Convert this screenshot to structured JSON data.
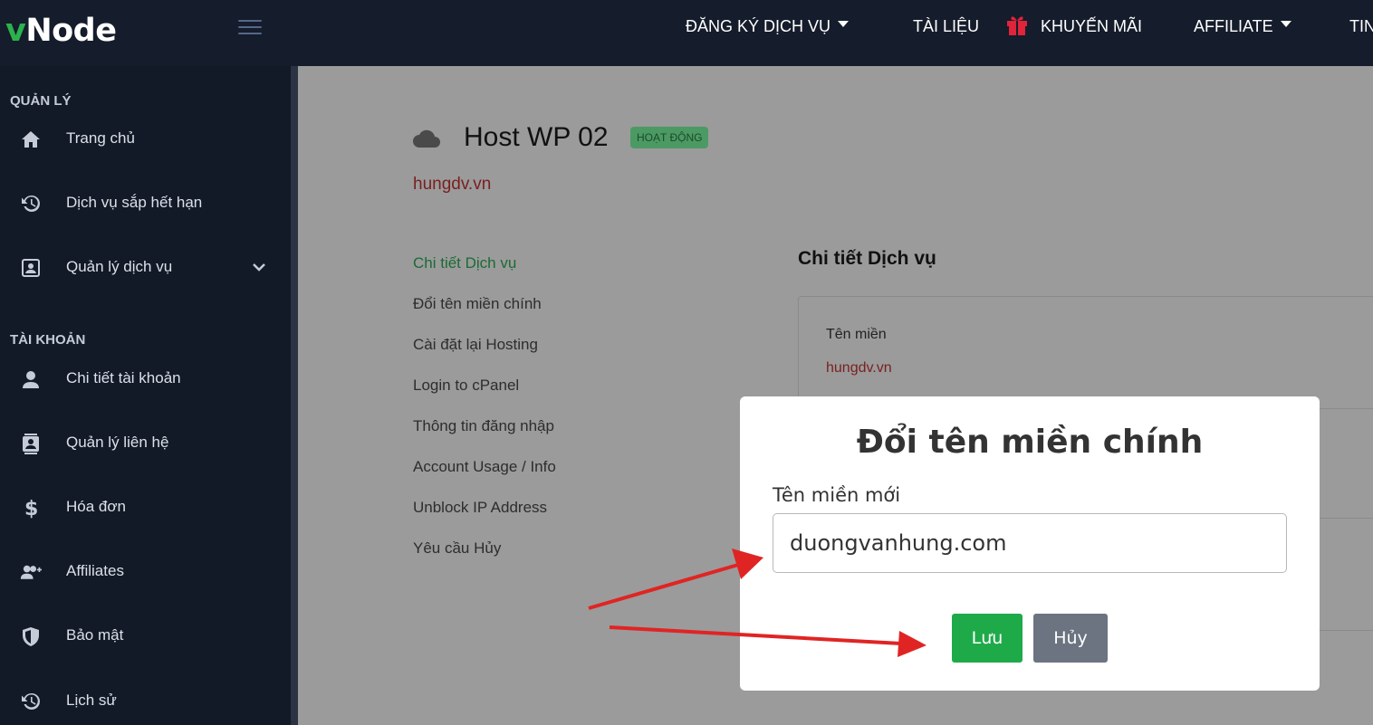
{
  "brand": {
    "logo_v": "v",
    "logo_rest": "Node"
  },
  "topnav": [
    {
      "label": "ĐĂNG KÝ DỊCH VỤ",
      "has_dropdown": true
    },
    {
      "label": "TÀI LIỆU",
      "has_dropdown": false
    },
    {
      "label": "KHUYẾN MÃI",
      "icon": "gift-icon"
    },
    {
      "label": "AFFILIATE",
      "has_dropdown": true
    },
    {
      "label": "TIN"
    }
  ],
  "sidebar": {
    "section_manage": "QUẢN LÝ",
    "section_account": "TÀI KHOẢN",
    "items": [
      {
        "label": "Trang chủ",
        "icon": "home-icon"
      },
      {
        "label": "Dịch vụ sắp hết hạn",
        "icon": "history-icon"
      },
      {
        "label": "Quản lý dịch vụ",
        "icon": "portrait-icon"
      },
      {
        "label": "Chi tiết tài khoản",
        "icon": "user-icon"
      },
      {
        "label": "Quản lý liên hệ",
        "icon": "contact-icon"
      },
      {
        "label": "Hóa đơn",
        "icon": "dollar-icon"
      },
      {
        "label": "Affiliates",
        "icon": "user-plus-icon"
      },
      {
        "label": "Bảo mật",
        "icon": "shield-icon"
      },
      {
        "label": "Lịch sử",
        "icon": "history-icon"
      }
    ]
  },
  "service": {
    "title": "Host WP 02",
    "status": "HOẠT ĐỘNG",
    "domain": "hungdv.vn",
    "menu": [
      "Chi tiết Dịch vụ",
      "Đổi tên miền chính",
      "Cài đặt lại Hosting",
      "Login to cPanel",
      "Thông tin đăng nhập",
      "Account Usage / Info",
      "Unblock IP Address",
      "Yêu cầu Hủy"
    ],
    "panel_title": "Chi tiết Dịch vụ",
    "field_label": "Tên miền",
    "field_value": "hungdv.vn"
  },
  "modal": {
    "title": "Đổi tên miền chính",
    "label": "Tên miền mới",
    "input_value": "duongvanhung.com",
    "save_label": "Lưu",
    "cancel_label": "Hủy"
  },
  "colors": {
    "topbar": "#151c2b",
    "sidebar": "#121a28",
    "accent_green": "#1faa4a",
    "annotation_red": "#e02424"
  }
}
